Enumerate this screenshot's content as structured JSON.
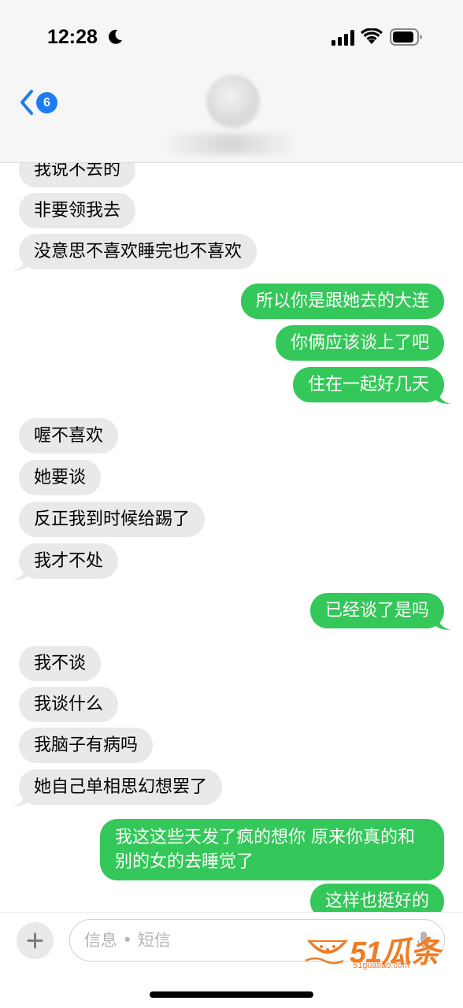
{
  "status_bar": {
    "time": "12:28"
  },
  "nav": {
    "back_badge": "6"
  },
  "messages": [
    {
      "side": "in",
      "text": "我说不去的"
    },
    {
      "side": "in",
      "text": "非要领我去"
    },
    {
      "side": "in",
      "text": "没意思不喜欢睡完也不喜欢"
    },
    {
      "side": "out",
      "text": "所以你是跟她去的大连"
    },
    {
      "side": "out",
      "text": "你俩应该谈上了吧"
    },
    {
      "side": "out",
      "text": "住在一起好几天"
    },
    {
      "side": "in",
      "text": "喔不喜欢"
    },
    {
      "side": "in",
      "text": "她要谈"
    },
    {
      "side": "in",
      "text": "反正我到时候给踢了"
    },
    {
      "side": "in",
      "text": "我才不处"
    },
    {
      "side": "out",
      "text": "已经谈了是吗"
    },
    {
      "side": "in",
      "text": "我不谈"
    },
    {
      "side": "in",
      "text": "我谈什么"
    },
    {
      "side": "in",
      "text": "我脑子有病吗"
    },
    {
      "side": "in",
      "text": "她自己单相思幻想罢了"
    },
    {
      "side": "out",
      "text": "我这这些天发了疯的想你 原来你真的和别的女的去睡觉了"
    },
    {
      "side": "out",
      "text": "这样也挺好的"
    }
  ],
  "composer": {
    "placeholder": "信息 • 短信"
  },
  "watermark": {
    "brand": "51瓜条",
    "url": "51guatiao.com"
  },
  "colors": {
    "incoming_bubble": "#e9e9eb",
    "outgoing_bubble": "#34c759",
    "badge": "#1e7cf2",
    "watermark": "#f07c24"
  }
}
